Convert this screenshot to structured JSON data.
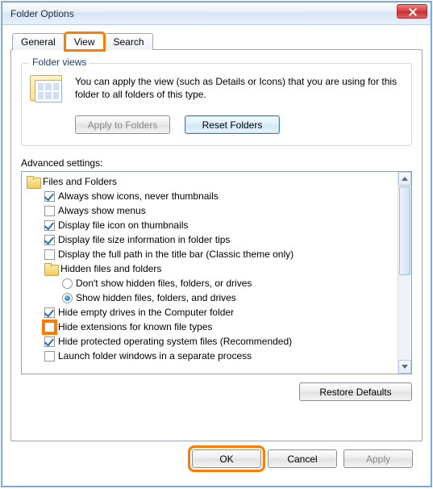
{
  "window": {
    "title": "Folder Options"
  },
  "tabs": {
    "general": "General",
    "view": "View",
    "search": "Search",
    "active": "View"
  },
  "folder_views": {
    "legend": "Folder views",
    "description": "You can apply the view (such as Details or Icons) that you are using for this folder to all folders of this type.",
    "apply_btn": "Apply to Folders",
    "reset_btn": "Reset Folders"
  },
  "advanced": {
    "label": "Advanced settings:",
    "root": "Files and Folders",
    "items": [
      {
        "type": "check",
        "checked": true,
        "label": "Always show icons, never thumbnails"
      },
      {
        "type": "check",
        "checked": false,
        "label": "Always show menus"
      },
      {
        "type": "check",
        "checked": true,
        "label": "Display file icon on thumbnails"
      },
      {
        "type": "check",
        "checked": true,
        "label": "Display file size information in folder tips"
      },
      {
        "type": "check",
        "checked": false,
        "label": "Display the full path in the title bar (Classic theme only)"
      },
      {
        "type": "folder",
        "label": "Hidden files and folders"
      },
      {
        "type": "radio",
        "selected": false,
        "label": "Don't show hidden files, folders, or drives"
      },
      {
        "type": "radio",
        "selected": true,
        "label": "Show hidden files, folders, and drives"
      },
      {
        "type": "check",
        "checked": true,
        "label": "Hide empty drives in the Computer folder"
      },
      {
        "type": "check",
        "checked": false,
        "label": "Hide extensions for known file types",
        "highlight": true
      },
      {
        "type": "check",
        "checked": true,
        "label": "Hide protected operating system files (Recommended)"
      },
      {
        "type": "check",
        "checked": false,
        "label": "Launch folder windows in a separate process"
      }
    ],
    "restore_btn": "Restore Defaults"
  },
  "footer": {
    "ok": "OK",
    "cancel": "Cancel",
    "apply": "Apply"
  }
}
